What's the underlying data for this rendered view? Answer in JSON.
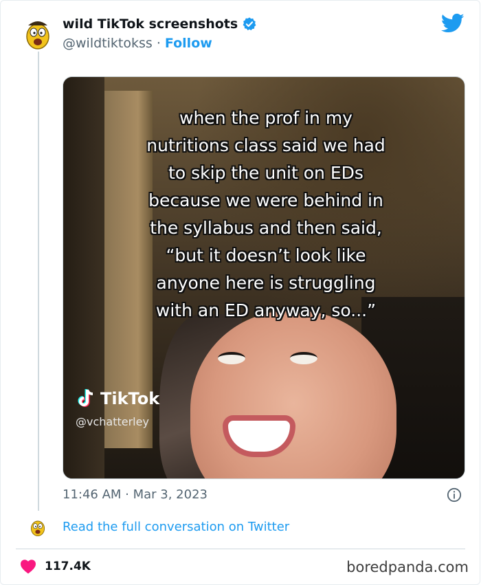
{
  "tweet": {
    "author_name": "wild TikTok screenshots",
    "author_handle": "@wildtiktokss",
    "separator": "·",
    "follow_label": "Follow",
    "timestamp": "11:46 AM · Mar 3, 2023",
    "read_full_label": "Read the full conversation on Twitter",
    "likes": "117.4K",
    "icons": {
      "verified": "verified-badge-icon",
      "bird": "twitter-bird-icon",
      "info": "info-icon",
      "heart": "heart-icon"
    },
    "colors": {
      "accent": "#1d9bf0",
      "heart": "#f91880",
      "text": "#0f1419",
      "muted": "#536471"
    }
  },
  "media": {
    "caption_lines": [
      "when the prof in my",
      "nutritions class said we had",
      "to skip the unit on EDs",
      "because we were behind in",
      "the syllabus and then said,",
      "“but it doesn’t look like",
      "anyone here is struggling",
      "with an ED anyway, so...”"
    ],
    "tiktok_brand": "TikTok",
    "tiktok_handle": "@vchatterley"
  },
  "watermark": "boredpanda.com"
}
